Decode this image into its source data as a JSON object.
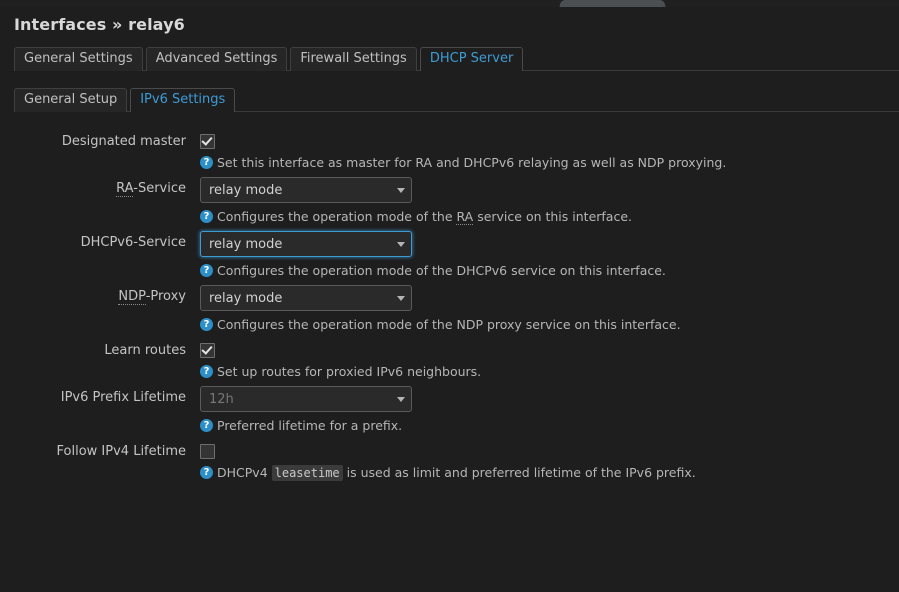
{
  "browser": {
    "tab_sliver": "partial-browser-tab"
  },
  "header": {
    "title_prefix": "Interfaces",
    "separator": "»",
    "title_name": "relay6"
  },
  "tabs_outer": [
    {
      "label": "General Settings",
      "active": false
    },
    {
      "label": "Advanced Settings",
      "active": false
    },
    {
      "label": "Firewall Settings",
      "active": false
    },
    {
      "label": "DHCP Server",
      "active": true
    }
  ],
  "tabs_inner": [
    {
      "label": "General Setup",
      "active": false
    },
    {
      "label": "IPv6 Settings",
      "active": true
    }
  ],
  "help_icon_glyph": "?",
  "caret_glyph": "▾",
  "colors": {
    "accent": "#3e9bd4",
    "help_icon": "#2d8fc8",
    "background": "#1e1e1e",
    "text": "#c8c8c8",
    "tab_inactive_bg": "#262626"
  },
  "form": {
    "rows": [
      {
        "label": "Designated master",
        "type": "checkbox",
        "checked": true,
        "help": "Set this interface as master for RA and DHCPv6 relaying as well as NDP proxying."
      },
      {
        "label_abbr": "RA",
        "label_rest": "-Service",
        "type": "select",
        "value": "relay mode",
        "focused": false,
        "placeholder": false,
        "help_pre": "Configures the operation mode of the ",
        "help_abbr": "RA",
        "help_post": " service on this interface."
      },
      {
        "label": "DHCPv6-Service",
        "type": "select",
        "value": "relay mode",
        "focused": true,
        "placeholder": false,
        "help": "Configures the operation mode of the DHCPv6 service on this interface."
      },
      {
        "label_abbr": "NDP",
        "label_rest": "-Proxy",
        "type": "select",
        "value": "relay mode",
        "focused": false,
        "placeholder": false,
        "help": "Configures the operation mode of the NDP proxy service on this interface."
      },
      {
        "label": "Learn routes",
        "type": "checkbox",
        "checked": true,
        "help": "Set up routes for proxied IPv6 neighbours."
      },
      {
        "label": "IPv6 Prefix Lifetime",
        "type": "select",
        "value": "12h",
        "focused": false,
        "placeholder": true,
        "help": "Preferred lifetime for a prefix."
      },
      {
        "label": "Follow IPv4 Lifetime",
        "type": "checkbox",
        "checked": false,
        "help_pre": "DHCPv4 ",
        "help_code": "leasetime",
        "help_post": " is used as limit and preferred lifetime of the IPv6 prefix."
      }
    ]
  }
}
